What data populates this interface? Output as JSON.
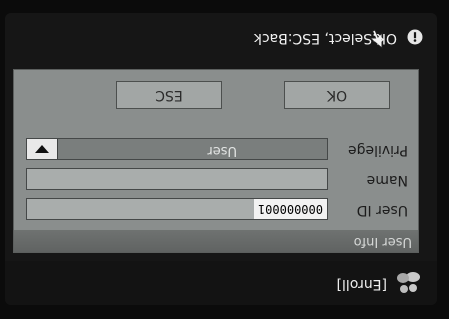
{
  "title": "[Enroll]",
  "section_title": "User Info",
  "fields": {
    "user_id": {
      "label": "User ID",
      "value": "000000001"
    },
    "name": {
      "label": "Name",
      "value": ""
    },
    "privilege": {
      "label": "Privilege",
      "value": "User"
    }
  },
  "buttons": {
    "ok": "OK",
    "esc": "ESC"
  },
  "footer_hint": "OK:Select, ESC:Back",
  "icons": {
    "title": "users-icon",
    "footer": "info-icon",
    "pointer": "mouse-pointer-icon"
  },
  "colors": {
    "panel": "#8a8e8d",
    "screen": "#161616",
    "field_bg": "#a9adac"
  }
}
